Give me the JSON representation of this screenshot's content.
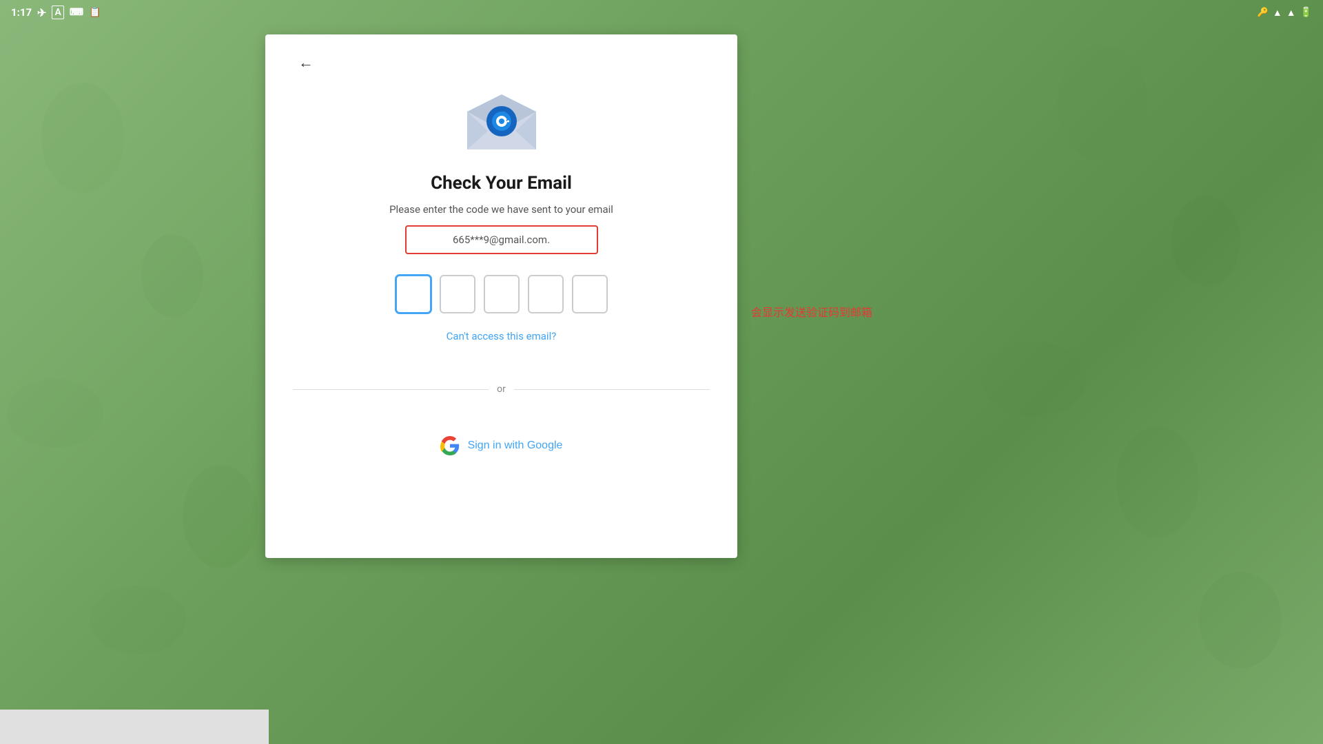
{
  "statusBar": {
    "time": "1:17",
    "icons": [
      "telegram",
      "A",
      "keyboard",
      "clipboard"
    ]
  },
  "background": {
    "color": "#7aaa6a"
  },
  "card": {
    "backButton": "←",
    "title": "Check Your Email",
    "subtitle": "Please enter the code we have sent to your email",
    "emailValue": "665***9@gmail.com.",
    "codeBoxes": [
      "",
      "",
      "",
      "",
      ""
    ],
    "cantAccessLink": "Can't access this email?",
    "dividerText": "or",
    "googleSignIn": "Sign in with Google"
  },
  "annotation": {
    "text": "会显示发送验证码到邮箱"
  }
}
